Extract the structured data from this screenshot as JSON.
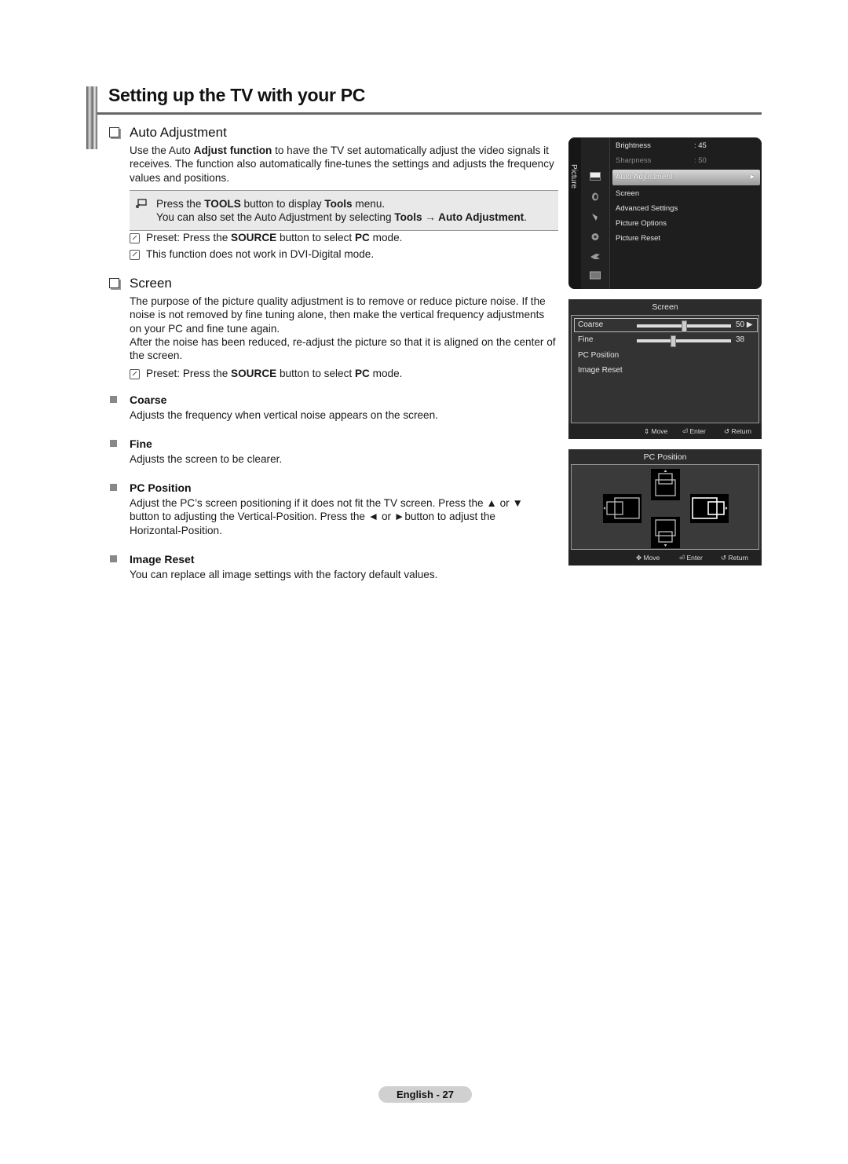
{
  "header": {
    "title": "Setting up the TV with your PC"
  },
  "auto_adjustment": {
    "heading": "Auto Adjustment",
    "body": [
      {
        "t": "Use the Auto "
      },
      {
        "b": "Adjust function"
      },
      {
        "t": " to have the TV set automatically adjust the video signals it receives. The function also automatically fine-tunes the settings and adjusts the frequency values and positions."
      }
    ],
    "tools_line1": [
      {
        "t": "Press the "
      },
      {
        "b": "TOOLS"
      },
      {
        "t": " button to display "
      },
      {
        "b": "Tools"
      },
      {
        "t": " menu."
      }
    ],
    "tools_line2": [
      {
        "t": "You can also set the Auto Adjustment by selecting "
      },
      {
        "b": "Tools → Auto Adjustment"
      },
      {
        "t": "."
      }
    ],
    "notes": [
      [
        {
          "t": "Preset: Press the "
        },
        {
          "b": "SOURCE"
        },
        {
          "t": " button to select "
        },
        {
          "b": "PC"
        },
        {
          "t": " mode."
        }
      ],
      [
        {
          "t": "This function does not work in DVI-Digital mode."
        }
      ]
    ]
  },
  "screen": {
    "heading": "Screen",
    "body1": "The purpose of the picture quality adjustment is to remove or reduce picture noise. If the noise is not removed by fine tuning alone, then make the vertical frequency adjustments on your PC and fine tune again.",
    "body2": "After the noise has been reduced, re-adjust the picture so that it is aligned on the center of the screen.",
    "note": [
      {
        "t": "Preset: Press the "
      },
      {
        "b": "SOURCE"
      },
      {
        "t": " button to select "
      },
      {
        "b": "PC"
      },
      {
        "t": " mode."
      }
    ],
    "items": [
      {
        "title": "Coarse",
        "desc": "Adjusts the frequency when vertical noise appears on the screen."
      },
      {
        "title": "Fine",
        "desc": "Adjusts the screen to be clearer."
      },
      {
        "title": "PC Position",
        "desc": "Adjust the PC’s screen positioning if it does not fit the TV screen. Press the ▲ or ▼ button to adjusting the Vertical-Position. Press the ◄ or ►button to adjust the Horizontal-Position."
      },
      {
        "title": "Image Reset",
        "desc": "You can replace all image settings with the factory default values."
      }
    ]
  },
  "tv_picture_menu": {
    "tab": "Picture",
    "items": [
      {
        "label": "Brightness",
        "value": ": 45",
        "dim": false
      },
      {
        "label": "Sharpness",
        "value": ": 50",
        "dim": true
      },
      {
        "label": "Auto Adjustment",
        "selected": true
      },
      {
        "label": "Screen"
      },
      {
        "label": "Advanced Settings"
      },
      {
        "label": "Picture Options"
      },
      {
        "label": "Picture Reset"
      }
    ]
  },
  "tv_screen_menu": {
    "title": "Screen",
    "rows": [
      {
        "label": "Coarse",
        "value": "50 ▶",
        "level_pct": 50
      },
      {
        "label": "Fine",
        "value": "38",
        "level_pct": 38
      },
      {
        "label": "PC Position"
      },
      {
        "label": "Image Reset"
      }
    ],
    "footer": {
      "move": "Move",
      "enter": "Enter",
      "return": "Return"
    }
  },
  "tv_pc_position": {
    "title": "PC Position",
    "footer": {
      "move": "Move",
      "enter": "Enter",
      "return": "Return"
    }
  },
  "footer": {
    "page_label": "English - 27"
  }
}
